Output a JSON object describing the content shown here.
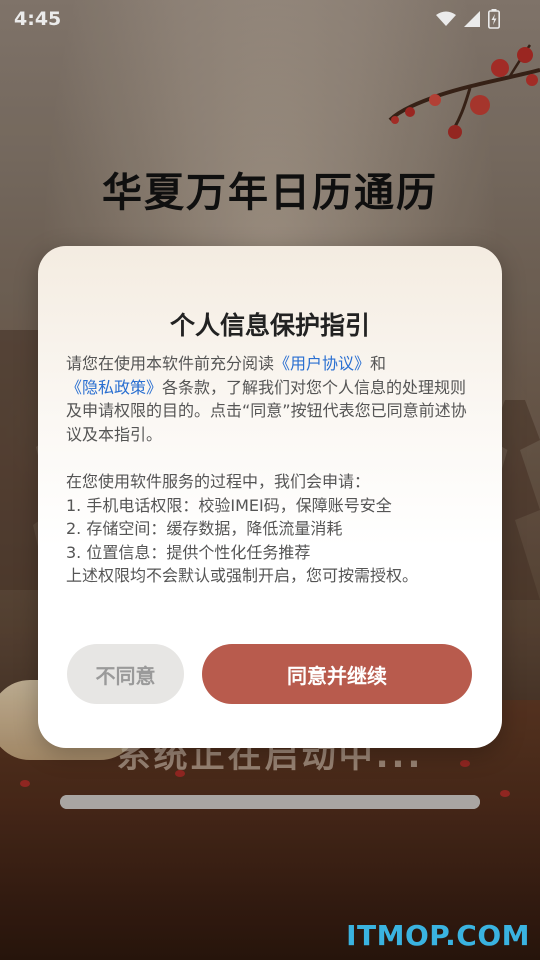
{
  "status_bar": {
    "time": "4:45",
    "icons": [
      "wifi-icon",
      "signal-icon",
      "battery-icon"
    ]
  },
  "app": {
    "title": "华夏万年日历通历",
    "loading_text": "系统正在启动中...",
    "progress_fraction": 1.0
  },
  "dialog": {
    "title": "个人信息保护指引",
    "intro_prefix": "请您在使用本软件前充分阅读",
    "user_agreement_link": "《用户协议》",
    "and": "和",
    "privacy_policy_link": "《隐私政策》",
    "intro_suffix": "各条款，了解我们对您个人信息的处理规则及申请权限的目的。点击“同意”按钮代表您已同意前述协议及本指引。",
    "permissions_intro": "在您使用软件服务的过程中，我们会申请：",
    "permissions": [
      "1. 手机电话权限：校验IMEI码，保障账号安全",
      "2. 存储空间：缓存数据，降低流量消耗",
      "3. 位置信息：提供个性化任务推荐"
    ],
    "permissions_note": "上述权限均不会默认或强制开启，您可按需授权。",
    "disagree_label": "不同意",
    "agree_label": "同意并继续"
  },
  "watermark": "ITMOP.COM",
  "colors": {
    "agree_button": "#b85b4d",
    "disagree_button": "#e7e6e4",
    "link": "#2a6fd1",
    "watermark": "#3ab3e0"
  }
}
